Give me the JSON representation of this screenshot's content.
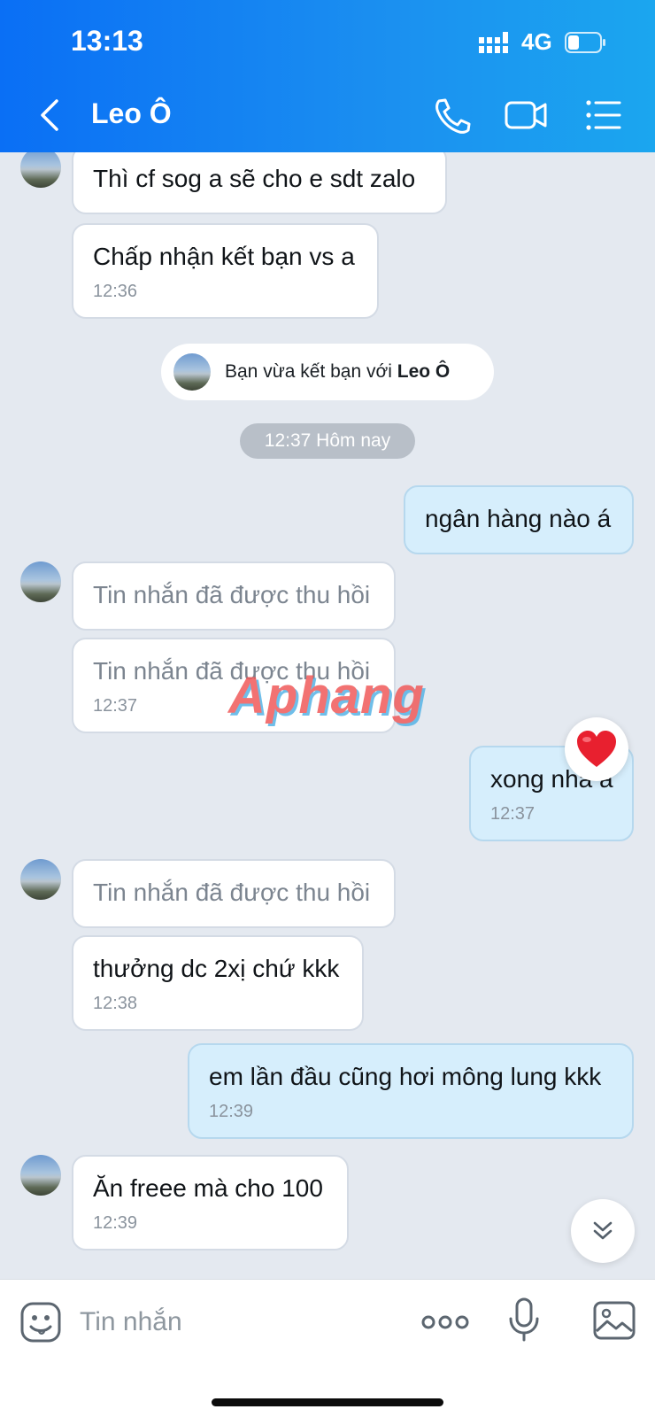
{
  "status_bar": {
    "time": "13:13",
    "network": "4G"
  },
  "header": {
    "title": "Leo Ô",
    "icons": [
      "back-icon",
      "phone-icon",
      "video-call-icon",
      "menu-list-icon"
    ]
  },
  "messages": [
    {
      "dir": "in",
      "text": "Thì cf sog a sẽ cho e sdt zalo",
      "time": ""
    },
    {
      "dir": "in",
      "text": "Chấp nhận kết bạn vs a",
      "time": "12:36"
    },
    {
      "dir": "out",
      "text": "ngân hàng nào á",
      "time": ""
    },
    {
      "dir": "in",
      "text": "Tin nhắn đã được thu hồi",
      "time": "",
      "recalled": true
    },
    {
      "dir": "in",
      "text": "Tin nhắn đã được thu hồi",
      "time": "12:37",
      "recalled": true
    },
    {
      "dir": "out",
      "text": "xong nha a",
      "time": "12:37",
      "reaction": "heart"
    },
    {
      "dir": "in",
      "text": "Tin nhắn đã được thu hồi",
      "time": "",
      "recalled": true
    },
    {
      "dir": "in",
      "text": "thưởng dc 2xị chứ kkk",
      "time": "12:38"
    },
    {
      "dir": "out",
      "text": "em lần đầu cũng hơi mông lung kkk",
      "time": "12:39"
    },
    {
      "dir": "in",
      "text": "Ăn freee mà cho 100",
      "time": "12:39"
    }
  ],
  "system_notice": {
    "prefix": "Bạn vừa kết bạn với ",
    "name": "Leo Ô"
  },
  "time_divider": "12:37 Hôm nay",
  "watermark": "Aphang",
  "composer": {
    "placeholder": "Tin nhắn"
  },
  "colors": {
    "header_start": "#0a6ff5",
    "header_end": "#1ba6ef",
    "outgoing_bubble": "#d6eefc",
    "incoming_bubble": "#ffffff",
    "chat_bg": "#e4e9f0",
    "reaction_heart": "#e8202f"
  }
}
